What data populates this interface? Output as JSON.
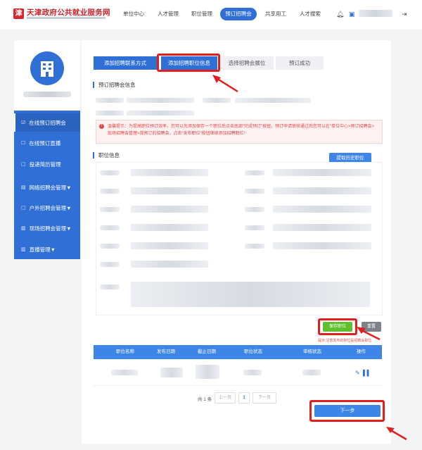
{
  "header": {
    "logo_mark": "津",
    "site_title": "天津政府公共就业服务网",
    "nav": [
      "单位中心",
      "人才管理",
      "职位管理",
      "预订招聘会",
      "共享用工",
      "人才搜索"
    ],
    "active_nav": "预订招聘会"
  },
  "sidebar": {
    "items": [
      {
        "icon": "☑",
        "label": "在线预订招聘会"
      },
      {
        "icon": "☐",
        "label": "在线预订直播"
      },
      {
        "icon": "▢",
        "label": "投递简历管理"
      },
      {
        "icon": "▤",
        "label": "网络招聘会管理▼"
      },
      {
        "icon": "▢",
        "label": "户外招聘会管理▼"
      },
      {
        "icon": "▥",
        "label": "现场招聘会管理▼"
      },
      {
        "icon": "▥",
        "label": "直播管理▼"
      }
    ]
  },
  "steps": [
    "添加招聘联系方式",
    "添加招聘职位信息",
    "选择招聘会展位",
    "预订成功"
  ],
  "booking_section_title": "预订招聘会信息",
  "notice_text": "温馨提示：为提高职位预订效率，您可以先添加保存一个职位后点击底部“完成预订”按钮，预订申请审核通过后您可以在“单位中心>预订招聘会>现场招聘会管理>我预订的招聘会，点击“发布职位”按钮继续添加招聘职位！",
  "position_section_title": "职位信息",
  "history_button": "提取历史职位",
  "save_button": "保存职位",
  "reset_button": "重置",
  "save_hint": "提示:注意发布的职位是招聘会职位",
  "table": {
    "headers": [
      "职位名称",
      "发布日期",
      "截止日期",
      "职位状态",
      "审核状态",
      "操作"
    ]
  },
  "pager": {
    "total": "共 1 条",
    "prev": "上一页",
    "current": "1",
    "next": "下一页"
  },
  "next_button": "下一步",
  "colors": {
    "primary": "#2f6fd6",
    "highlight": "#e02020",
    "save_green": "#5fbf2e",
    "brand_red": "#c8242b"
  }
}
